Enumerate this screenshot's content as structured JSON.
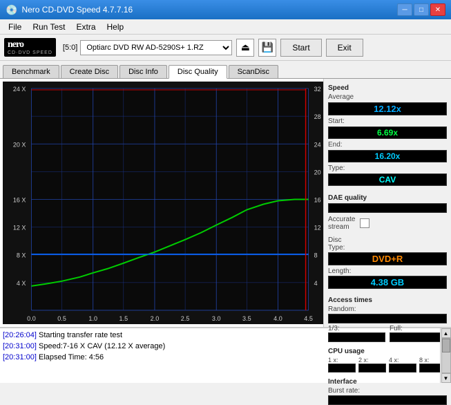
{
  "title_bar": {
    "title": "Nero CD-DVD Speed 4.7.7.16",
    "min_label": "─",
    "max_label": "□",
    "close_label": "✕"
  },
  "menu": {
    "items": [
      "File",
      "Run Test",
      "Extra",
      "Help"
    ]
  },
  "toolbar": {
    "logo_main": "nero",
    "logo_sub": "CD·DVD SPEED",
    "drive_label": "[5:0]",
    "drive_name": "Optiarc DVD RW AD-5290S+ 1.RZ",
    "start_label": "Start",
    "exit_label": "Exit"
  },
  "tabs": [
    {
      "label": "Benchmark",
      "active": false
    },
    {
      "label": "Create Disc",
      "active": false
    },
    {
      "label": "Disc Info",
      "active": false
    },
    {
      "label": "Disc Quality",
      "active": true
    },
    {
      "label": "ScanDisc",
      "active": false
    }
  ],
  "speed_section": {
    "title": "Speed",
    "average_label": "Average",
    "average_value": "12.12x",
    "start_label": "Start:",
    "start_value": "6.69x",
    "end_label": "End:",
    "end_value": "16.20x",
    "type_label": "Type:",
    "type_value": "CAV"
  },
  "dae_section": {
    "title": "DAE quality",
    "value": "",
    "accurate_label": "Accurate",
    "stream_label": "stream"
  },
  "disc_section": {
    "title": "Disc",
    "type_label": "Type:",
    "type_value": "DVD+R",
    "length_label": "Length:",
    "length_value": "4.38 GB"
  },
  "access_section": {
    "title": "Access times",
    "random_label": "Random:",
    "random_value": "",
    "one_third_label": "1/3:",
    "one_third_value": "",
    "full_label": "Full:",
    "full_value": ""
  },
  "cpu_section": {
    "title": "CPU usage",
    "one_x_label": "1 x:",
    "one_x_value": "",
    "two_x_label": "2 x:",
    "two_x_value": "",
    "four_x_label": "4 x:",
    "four_x_value": "",
    "eight_x_label": "8 x:",
    "eight_x_value": ""
  },
  "interface_section": {
    "title": "Interface",
    "burst_label": "Burst rate:",
    "burst_value": ""
  },
  "chart": {
    "y_labels_left": [
      "24 X",
      "20 X",
      "16 X",
      "12 X",
      "8 X",
      "4 X"
    ],
    "y_labels_right": [
      "32",
      "28",
      "24",
      "20",
      "16",
      "12",
      "8",
      "4"
    ],
    "x_labels": [
      "0.0",
      "0.5",
      "1.0",
      "1.5",
      "2.0",
      "2.5",
      "3.0",
      "3.5",
      "4.0",
      "4.5"
    ]
  },
  "log": {
    "entries": [
      {
        "time": "[20:26:04]",
        "text": "Starting transfer rate test"
      },
      {
        "time": "[20:31:00]",
        "text": "Speed:7-16 X CAV (12.12 X average)"
      },
      {
        "time": "[20:31:00]",
        "text": "Elapsed Time: 4:56"
      }
    ]
  }
}
